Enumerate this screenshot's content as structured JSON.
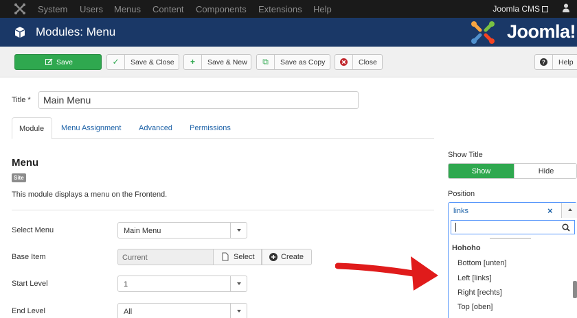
{
  "topbar": {
    "menu": [
      "System",
      "Users",
      "Menus",
      "Content",
      "Components",
      "Extensions",
      "Help"
    ],
    "site_link": "Joomla CMS",
    "icons": [
      "joomla-logo-icon",
      "external-link-icon",
      "user-icon"
    ]
  },
  "header": {
    "title": "Modules: Menu",
    "brand": "Joomla!",
    "icons": [
      "cube-icon",
      "joomla-brand-logo"
    ]
  },
  "toolbar": {
    "save": "Save",
    "save_close": "Save & Close",
    "save_new": "Save & New",
    "save_copy": "Save as Copy",
    "close": "Close",
    "help": "Help",
    "colors": {
      "save_bg": "#2fa84f",
      "close_icon": "#c0262c"
    }
  },
  "form": {
    "title_label": "Title *",
    "title_value": "Main Menu"
  },
  "tabs": [
    "Module",
    "Menu Assignment",
    "Advanced",
    "Permissions"
  ],
  "module": {
    "heading": "Menu",
    "badge": "Site",
    "description": "This module displays a menu on the Frontend."
  },
  "fields": {
    "select_menu": {
      "label": "Select Menu",
      "value": "Main Menu"
    },
    "base_item": {
      "label": "Base Item",
      "value": "Current",
      "select_btn": "Select",
      "create_btn": "Create"
    },
    "start_level": {
      "label": "Start Level",
      "value": "1"
    },
    "end_level": {
      "label": "End Level",
      "value": "All"
    }
  },
  "show_title": {
    "label": "Show Title",
    "on": "Show",
    "off": "Hide",
    "selected": "Show"
  },
  "position": {
    "label": "Position",
    "value": "links",
    "clear": "×",
    "search_value": "",
    "group": "Hohoho",
    "options": [
      "Bottom [unten]",
      "Left [links]",
      "Right [rechts]",
      "Top [oben]"
    ]
  },
  "colors": {
    "header_bg": "#1a3867",
    "topbar_bg": "#1a1a1a",
    "accent_green": "#2fa84f",
    "link_blue": "#1f63a8",
    "annotation_red": "#e01b1b"
  }
}
